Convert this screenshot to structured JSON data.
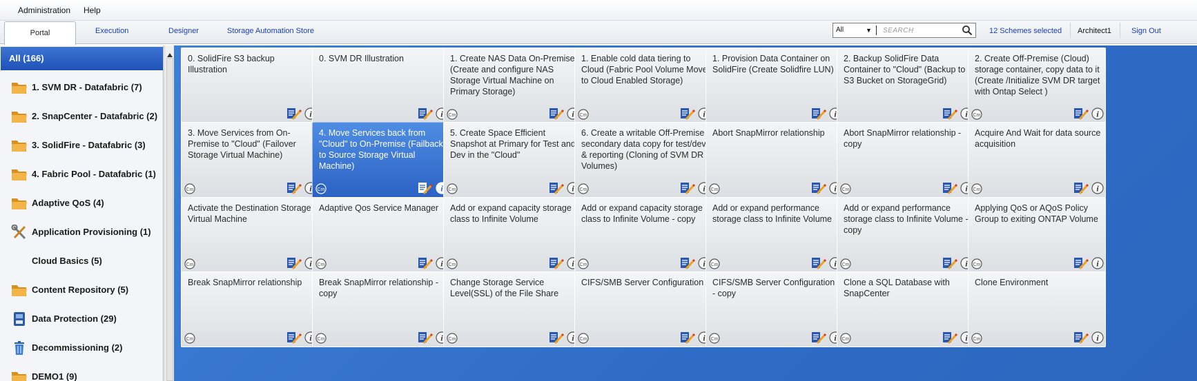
{
  "menu": {
    "items": [
      "Administration",
      "Help"
    ]
  },
  "tabs": [
    "Portal",
    "Execution",
    "Designer",
    "Storage Automation Store"
  ],
  "search": {
    "scope": "All",
    "placeholder": "SEARCH"
  },
  "toolbar": {
    "schemes": "12 Schemes selected",
    "user": "Architect1",
    "signout": "Sign Out"
  },
  "colors": {
    "accent": "#1f57bc",
    "tile_area": "#336fc8",
    "link": "#1a3fb5"
  },
  "sidebar": {
    "all_label": "All (166)",
    "items": [
      {
        "label": "1. SVM DR - Datafabric (7)",
        "icon": "folder-icon"
      },
      {
        "label": "2. SnapCenter - Datafabric (2)",
        "icon": "folder-icon"
      },
      {
        "label": "3. SolidFire - Datafabric (3)",
        "icon": "folder-icon"
      },
      {
        "label": "4. Fabric Pool - Datafabric (1)",
        "icon": "folder-icon"
      },
      {
        "label": "Adaptive QoS (4)",
        "icon": "folder-icon"
      },
      {
        "label": "Application Provisioning (1)",
        "icon": "tools-icon"
      },
      {
        "label": "Cloud Basics (5)",
        "icon": "none"
      },
      {
        "label": "Content Repository (5)",
        "icon": "folder-icon"
      },
      {
        "label": "Data Protection (29)",
        "icon": "data-protection-icon"
      },
      {
        "label": "Decommissioning (2)",
        "icon": "trash-icon"
      },
      {
        "label": "DEMO1 (9)",
        "icon": "folder-icon"
      }
    ]
  },
  "tiles": [
    {
      "title": "0. SolidFire S3 backup Illustration",
      "cm": false
    },
    {
      "title": "0. SVM DR Illustration",
      "cm": false
    },
    {
      "title": "1. Create NAS Data On-Premise (Create and configure NAS Storage Virtual Machine on Primary Storage)",
      "cm": true
    },
    {
      "title": "1. Enable cold data tiering to Cloud (Fabric Pool Volume Move to Cloud Enabled Storage)",
      "cm": true
    },
    {
      "title": "1. Provision Data Container on SolidFire (Create Solidfire LUN)",
      "cm": false
    },
    {
      "title": "2. Backup SolidFire Data Container to \"Cloud\" (Backup to S3 Bucket on StorageGrid)",
      "cm": false
    },
    {
      "title": "2. Create Off-Premise (Cloud) storage container, copy data to it (Create /Initialize SVM DR target with Ontap Select )",
      "cm": true
    },
    {
      "title": "3. Move Services from  On-Premise to \"Cloud\" (Failover Storage Virtual Machine)",
      "cm": true
    },
    {
      "title": "4. Move Services back from \"Cloud\" to On-Premise (Failback to Source Storage Virtual Machine)",
      "cm": true,
      "selected": true
    },
    {
      "title": "5. Create Space Efficient Snapshot at Primary for Test and Dev in the \"Cloud\"",
      "cm": true
    },
    {
      "title": "6. Create a writable Off-Premise secondary data copy for test/dev & reporting (Cloning of SVM DR Volumes)",
      "cm": true
    },
    {
      "title": "Abort SnapMirror relationship",
      "cm": true
    },
    {
      "title": "Abort SnapMirror relationship - copy",
      "cm": true
    },
    {
      "title": "Acquire And Wait for data source acquisition",
      "cm": true
    },
    {
      "title": "Activate the Destination Storage Virtual Machine",
      "cm": true
    },
    {
      "title": "Adaptive Qos Service Manager",
      "cm": true
    },
    {
      "title": "Add or expand capacity storage class to Infinite Volume",
      "cm": true
    },
    {
      "title": "Add or expand capacity storage class to Infinite Volume - copy",
      "cm": true
    },
    {
      "title": "Add or expand performance storage class to Infinite Volume",
      "cm": true
    },
    {
      "title": "Add or expand performance storage class to Infinite Volume - copy",
      "cm": true
    },
    {
      "title": "Applying QoS or AQoS Policy Group to exiting ONTAP Volume",
      "cm": true
    },
    {
      "title": "Break SnapMirror relationship",
      "cm": true
    },
    {
      "title": "Break SnapMirror relationship - copy",
      "cm": true
    },
    {
      "title": "Change Storage Service Level(SSL) of the File Share",
      "cm": true
    },
    {
      "title": "CIFS/SMB  Server Configuration",
      "cm": true
    },
    {
      "title": "CIFS/SMB  Server Configuration - copy",
      "cm": true
    },
    {
      "title": "Clone a SQL Database with SnapCenter",
      "cm": true
    },
    {
      "title": "Clone Environment",
      "cm": true
    }
  ]
}
